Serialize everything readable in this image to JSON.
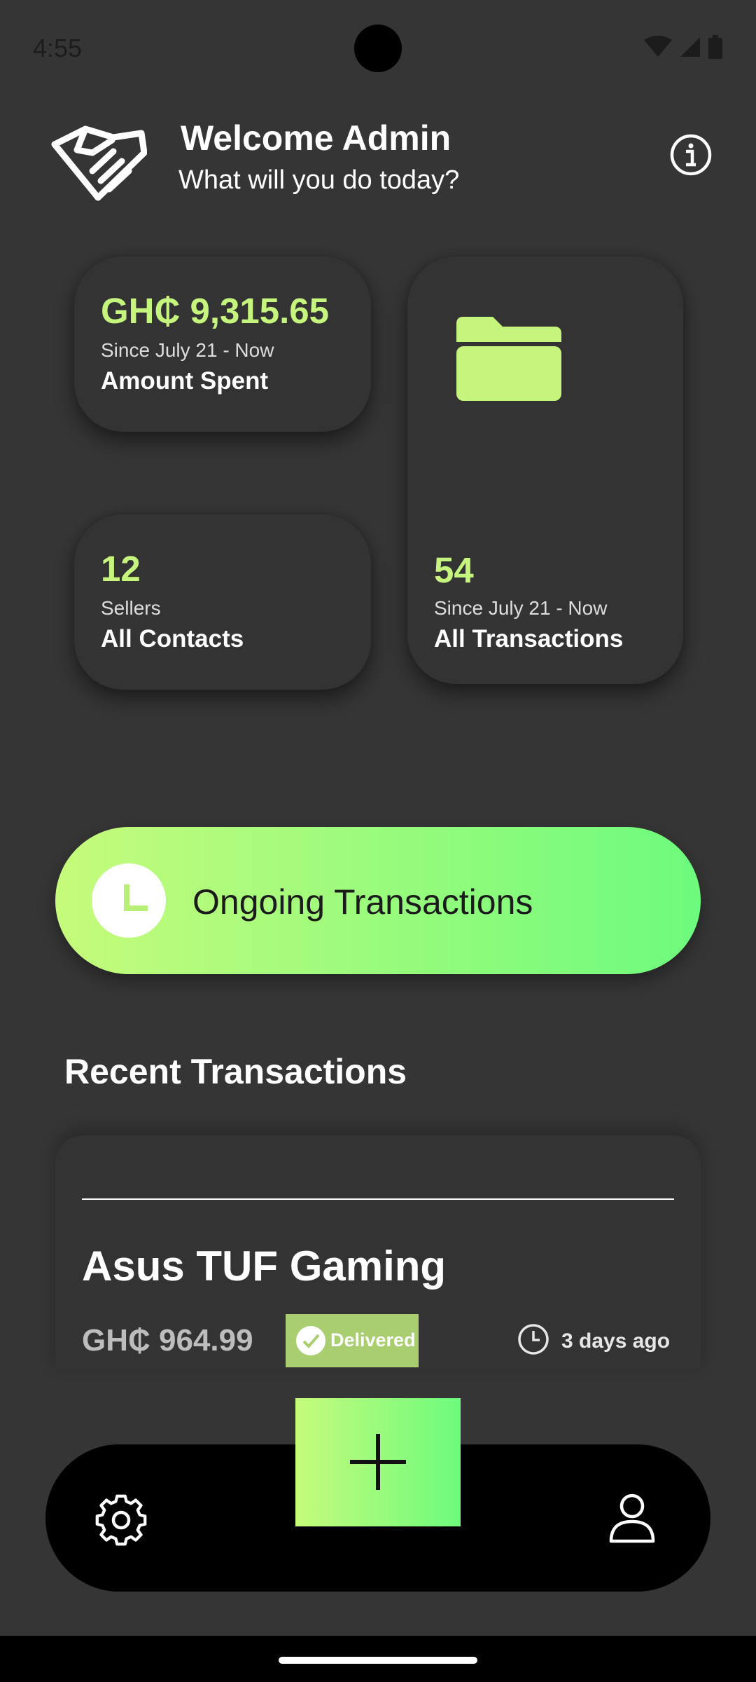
{
  "status_bar": {
    "time": "4:55"
  },
  "header": {
    "title": "Welcome Admin",
    "subtitle": "What will you do today?"
  },
  "cards": {
    "amount_spent": {
      "value": "GH₵ 9,315.65",
      "period": "Since July 21 - Now",
      "label": "Amount Spent"
    },
    "all_contacts": {
      "value": "12",
      "caption": "Sellers",
      "label": "All Contacts"
    },
    "all_transactions": {
      "value": "54",
      "period": "Since July 21 - Now",
      "label": "All Transactions"
    }
  },
  "ongoing": {
    "label": "Ongoing Transactions"
  },
  "recent": {
    "title": "Recent Transactions",
    "items": [
      {
        "name": "Asus TUF Gaming",
        "price": "GH₵ 964.99",
        "status": "Delivered",
        "time": "3 days ago"
      }
    ]
  },
  "colors": {
    "background": "#353535",
    "accent": "#c6f57e",
    "gradient_start": "#c6fb7b",
    "gradient_end": "#6dfb7d",
    "badge": "#a8ce70"
  },
  "icons": {
    "logo": "handshake-icon",
    "info": "info-icon",
    "folder": "folder-icon",
    "clock": "clock-icon",
    "check": "check-icon",
    "add": "plus-icon",
    "settings": "gear-icon",
    "profile": "user-icon"
  }
}
